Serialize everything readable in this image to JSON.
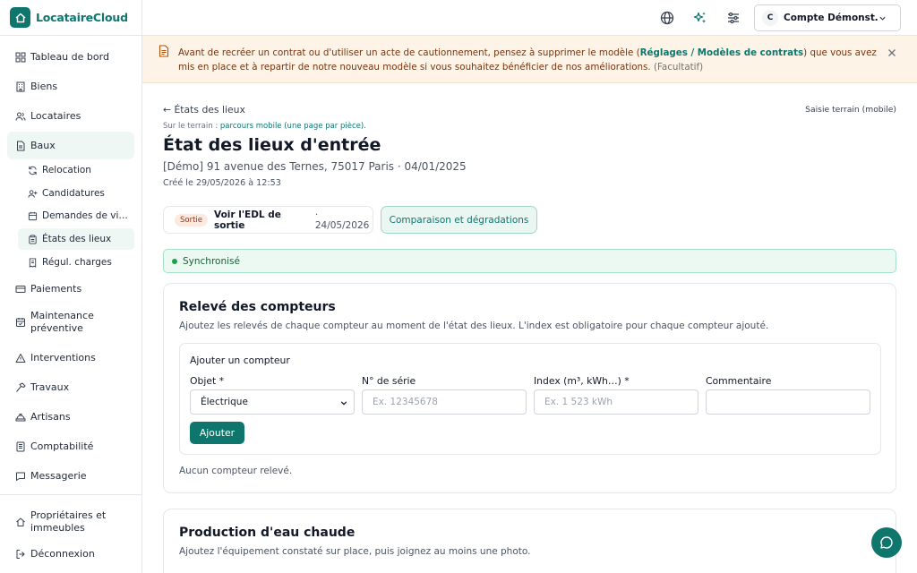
{
  "brand": {
    "name": "LocataireCloud"
  },
  "sidebar": {
    "items": [
      {
        "label": "Tableau de bord",
        "icon": "grid-icon"
      },
      {
        "label": "Biens",
        "icon": "building-icon"
      },
      {
        "label": "Locataires",
        "icon": "users-icon"
      },
      {
        "label": "Baux",
        "icon": "file-icon",
        "active": true
      },
      {
        "label": "Paiements",
        "icon": "card-icon"
      },
      {
        "label": "Maintenance préventive",
        "icon": "calendar-check-icon"
      },
      {
        "label": "Interventions",
        "icon": "alert-icon"
      },
      {
        "label": "Travaux",
        "icon": "hammer-icon"
      },
      {
        "label": "Artisans",
        "icon": "hard-hat-icon"
      },
      {
        "label": "Comptabilité",
        "icon": "ledger-icon"
      },
      {
        "label": "Messagerie",
        "icon": "message-icon"
      },
      {
        "label": "Propriétaires et immeubles",
        "icon": "home-icon"
      },
      {
        "label": "Déconnexion",
        "icon": "logout-icon"
      }
    ],
    "subitems": [
      {
        "label": "Relocation",
        "icon": "refresh-icon"
      },
      {
        "label": "Candidatures",
        "icon": "user-plus-icon"
      },
      {
        "label": "Demandes de vi…",
        "icon": "calendar-icon"
      },
      {
        "label": "États des lieux",
        "icon": "clipboard-icon",
        "active": true
      },
      {
        "label": "Régul. charges",
        "icon": "receipt-icon"
      }
    ]
  },
  "topbar": {
    "account_initial": "C",
    "account_name": "Compte Démonst…"
  },
  "banner": {
    "text_before": "Avant de recréer un contrat ou d'utiliser un acte de cautionnement, pensez à supprimer le modèle (",
    "link": "Réglages / Modèles de contrats",
    "text_after": ") que vous avez mis en place et à repartir de notre nouveau modèle si vous souhaitez bénéficier de nos améliorations. ",
    "optional": "(Facultatif)"
  },
  "page": {
    "back_link": "← États des lieux",
    "mobile_button": "Saisie terrain (mobile)",
    "terrain_prefix": "Sur le terrain : ",
    "terrain_link": "parcours mobile (une page par pièce).",
    "title": "État des lieux d'entrée",
    "subtitle": "[Démo] 91 avenue des Ternes, 75017 Paris · 04/01/2025",
    "created": "Créé le 29/05/2026 à 12:53",
    "sortie_badge": "Sortie",
    "sortie_label": "Voir l'EDL de sortie",
    "sortie_date": "· 24/05/2026",
    "compare_button": "Comparaison et dégradations",
    "sync_status": "Synchronisé"
  },
  "meters": {
    "title": "Relevé des compteurs",
    "description": "Ajoutez les relevés de chaque compteur au moment de l'état des lieux. L'index est obligatoire pour chaque compteur ajouté.",
    "form_title": "Ajouter un compteur",
    "object_label": "Objet *",
    "object_value": "Électrique",
    "serial_label": "N° de série",
    "serial_placeholder": "Ex. 12345678",
    "index_label": "Index (m³, kWh…) *",
    "index_placeholder": "Ex. 1 523 kWh",
    "comment_label": "Commentaire",
    "comment_placeholder": "",
    "add_button": "Ajouter",
    "empty": "Aucun compteur relevé."
  },
  "hot_water": {
    "title": "Production d'eau chaude",
    "description": "Ajoutez l'équipement constaté sur place, puis joignez au moins une photo."
  },
  "colors": {
    "accent": "#0f766e",
    "banner_bg": "#fdf3e7",
    "sync_bg": "#ecf8f2",
    "active_nav_bg": "#eef7f4"
  }
}
